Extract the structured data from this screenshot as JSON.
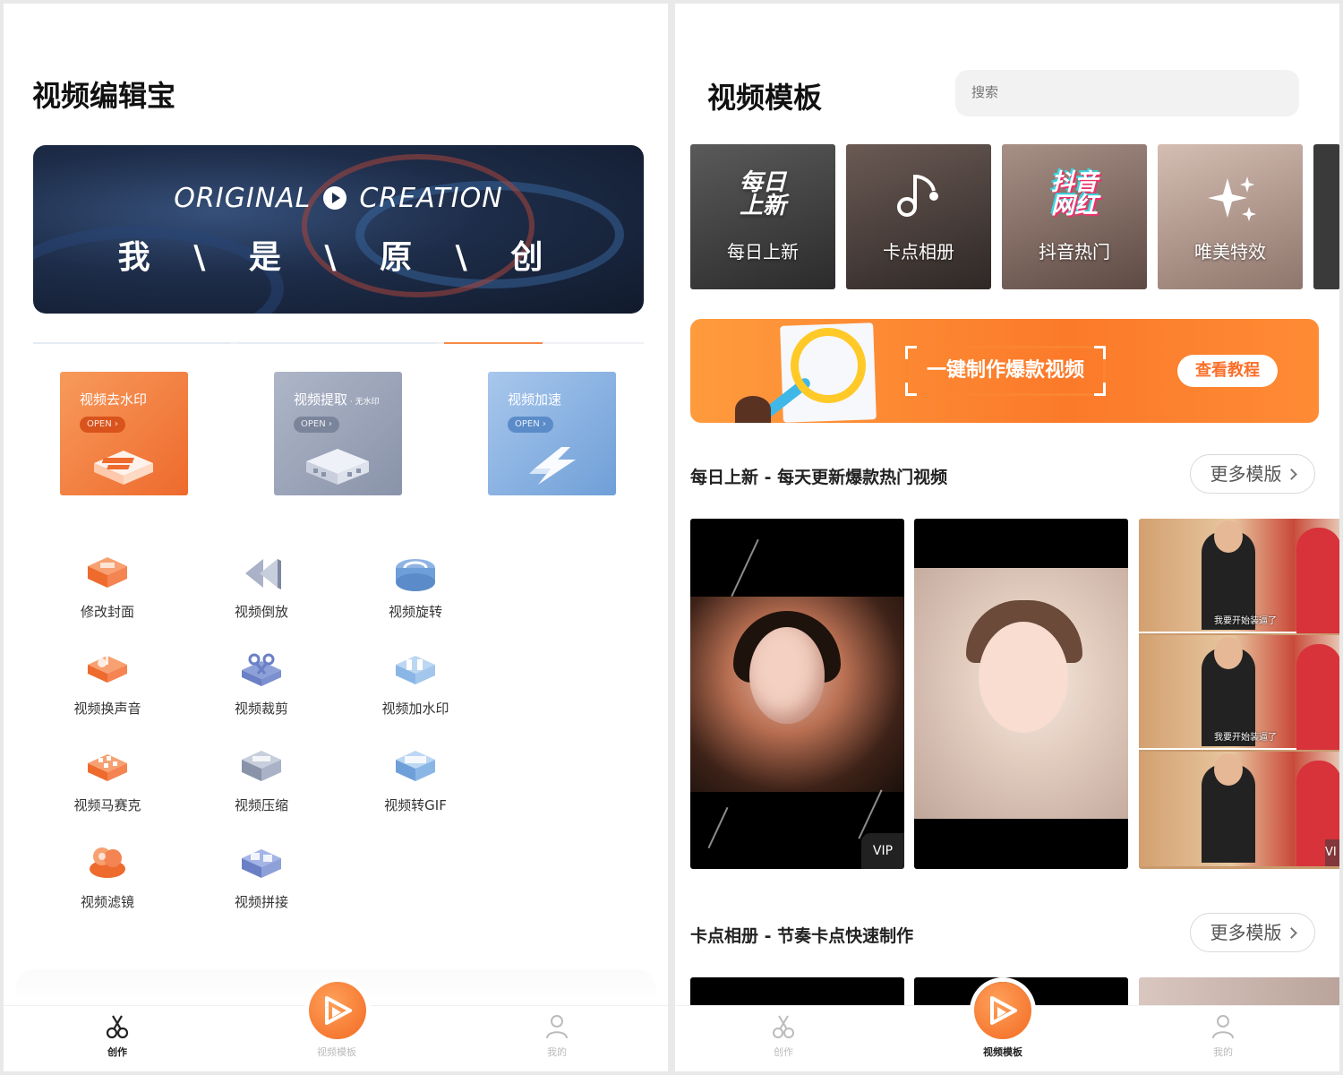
{
  "left": {
    "app_title": "视频编辑宝",
    "hero": {
      "line1_a": "ORIGINAL",
      "line1_b": "CREATION",
      "line2": "我 \\ 是 \\ 原 \\ 创"
    },
    "feature_cards": [
      {
        "title": "视频去水印",
        "subtitle": "",
        "open": "OPEN ›",
        "icon": "watermark-remove-icon"
      },
      {
        "title": "视频提取",
        "subtitle": " · 无水印",
        "open": "OPEN ›",
        "icon": "film-extract-icon"
      },
      {
        "title": "视频加速",
        "subtitle": "",
        "open": "OPEN ›",
        "icon": "lightning-icon"
      }
    ],
    "tools": [
      {
        "label": "修改封面",
        "icon": "cover-icon"
      },
      {
        "label": "视频倒放",
        "icon": "rewind-icon"
      },
      {
        "label": "视频旋转",
        "icon": "rotate-icon"
      },
      {
        "label": "视频换声音",
        "icon": "audio-swap-icon"
      },
      {
        "label": "视频裁剪",
        "icon": "scissors-icon"
      },
      {
        "label": "视频加水印",
        "icon": "add-watermark-icon"
      },
      {
        "label": "视频马赛克",
        "icon": "mosaic-icon"
      },
      {
        "label": "视频压缩",
        "icon": "compress-icon"
      },
      {
        "label": "视频转GIF",
        "icon": "gif-icon"
      },
      {
        "label": "视频滤镜",
        "icon": "filter-icon"
      },
      {
        "label": "视频拼接",
        "icon": "merge-icon"
      }
    ],
    "tabbar": {
      "create": "创作",
      "templates": "视频模板",
      "mine": "我的",
      "active": "create"
    }
  },
  "right": {
    "title": "视频模板",
    "search_placeholder": "搜索",
    "categories": [
      {
        "art": "每日\n上新",
        "label": "每日上新"
      },
      {
        "art": "",
        "label": "卡点相册"
      },
      {
        "art": "抖音\n网红",
        "label": "抖音热门"
      },
      {
        "art": "",
        "label": "唯美特效"
      }
    ],
    "promo": {
      "text": "一键制作爆款视频",
      "button": "查看教程"
    },
    "section1": {
      "title": "每日上新 - 每天更新爆款热门视频",
      "more": "更多模版"
    },
    "section2": {
      "title": "卡点相册 - 节奏卡点快速制作",
      "more": "更多模版"
    },
    "tile_badges": {
      "vip": "VIP",
      "vip_cut": "VI",
      "caption": "我要开始装逼了"
    },
    "tabbar": {
      "create": "创作",
      "templates": "视频模板",
      "mine": "我的",
      "active": "templates"
    }
  },
  "colors": {
    "accent": "#f26a22",
    "watermark_card": "#ee6a2d",
    "extract_card": "#8993a9",
    "speed_card": "#6f9fd8",
    "promo": "#fb7a2a"
  }
}
